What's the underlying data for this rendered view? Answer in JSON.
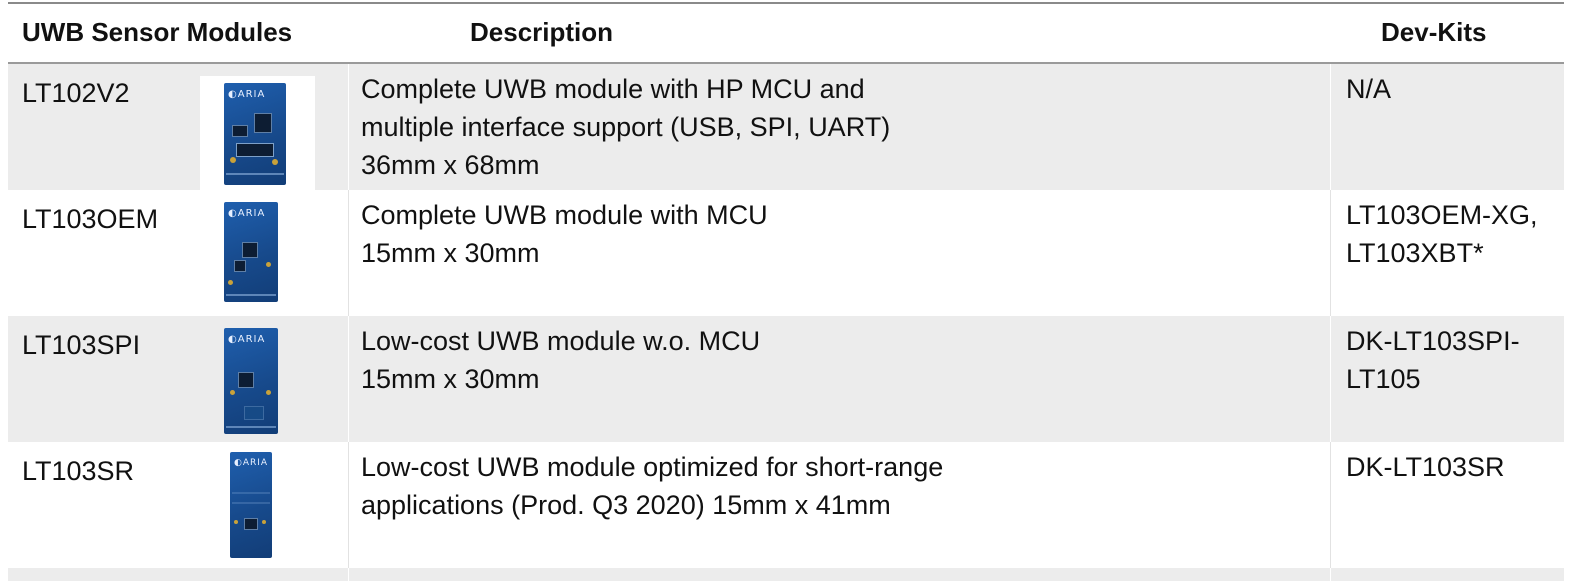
{
  "table": {
    "headers": {
      "modules": "UWB Sensor Modules",
      "description": "Description",
      "devkits": "Dev-Kits"
    },
    "rows": [
      {
        "name": "LT102V2",
        "description": [
          "Complete UWB module with HP MCU and",
          "multiple interface support (USB, SPI, UART)",
          "36mm x 68mm"
        ],
        "devkits": [
          "N/A"
        ],
        "image": "lt102v2-module-photo"
      },
      {
        "name": "LT103OEM",
        "description": [
          "Complete UWB module with MCU",
          "15mm x 30mm"
        ],
        "devkits": [
          "LT103OEM-XG,",
          "LT103XBT*"
        ],
        "image": "lt103oem-module-photo"
      },
      {
        "name": "LT103SPI",
        "description": [
          "Low-cost UWB module w.o. MCU",
          "15mm x 30mm"
        ],
        "devkits": [
          "DK-LT103SPI-",
          "LT105"
        ],
        "image": "lt103spi-module-photo"
      },
      {
        "name": "LT103SR",
        "description": [
          "Low-cost UWB module optimized for short-range",
          "applications (Prod. Q3 2020) 15mm x 41mm"
        ],
        "devkits": [
          "DK-LT103SR"
        ],
        "image": "lt103sr-module-photo"
      }
    ]
  },
  "colors": {
    "row_shaded": "#ececec",
    "row_white": "#ffffff",
    "pcb_blue": "#1f5fae"
  }
}
